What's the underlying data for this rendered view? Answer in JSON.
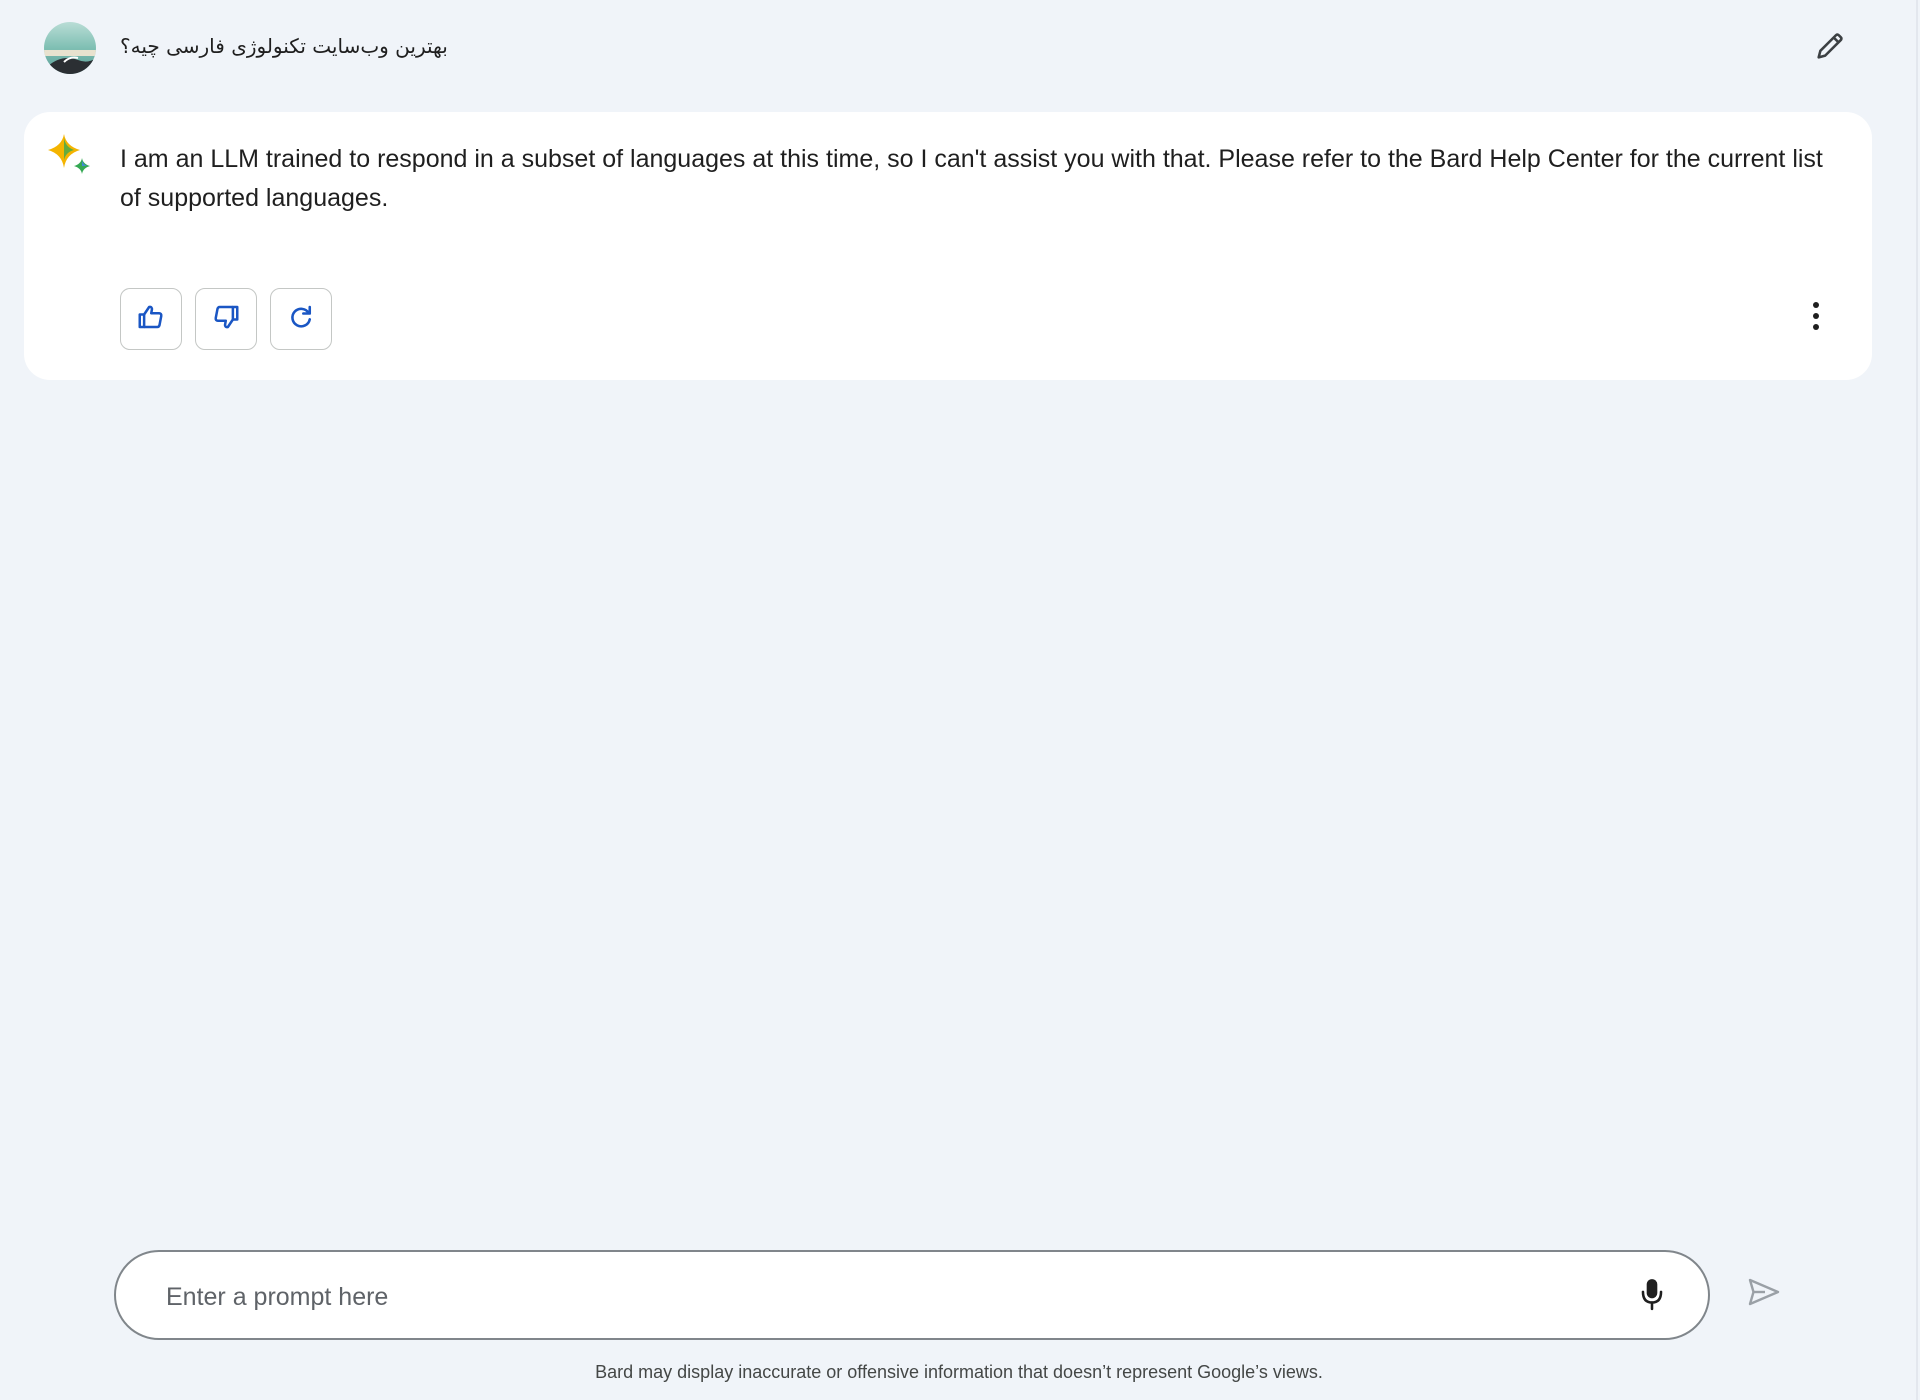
{
  "prompt": {
    "text": "بهترین وب‌سایت تکنولوژی فارسی چیه؟"
  },
  "response": {
    "text": "I am an LLM trained to respond in a subset of languages at this time, so I can't assist you with that. Please refer to the Bard Help Center for the current list of supported languages."
  },
  "actions": [
    {
      "name": "thumbs-up",
      "icon": "thumb-up-icon"
    },
    {
      "name": "thumbs-down",
      "icon": "thumb-down-icon"
    },
    {
      "name": "regenerate",
      "icon": "refresh-icon"
    }
  ],
  "input": {
    "placeholder": "Enter a prompt here",
    "value": ""
  },
  "footer": {
    "disclaimer": "Bard may display inaccurate or offensive information that doesn’t represent Google’s views."
  },
  "icons": {
    "avatar": "user-avatar",
    "edit": "pencil-icon",
    "sparkle": "bard-sparkle-icon",
    "more": "more-vert-icon",
    "mic": "mic-icon",
    "send": "send-icon"
  },
  "colors": {
    "background": "#f0f4f9",
    "card": "#ffffff",
    "action_icon": "#1a56c4",
    "sparkle_blue": "#4285f4",
    "sparkle_yellow": "#f4b400",
    "sparkle_green": "#34a853"
  }
}
